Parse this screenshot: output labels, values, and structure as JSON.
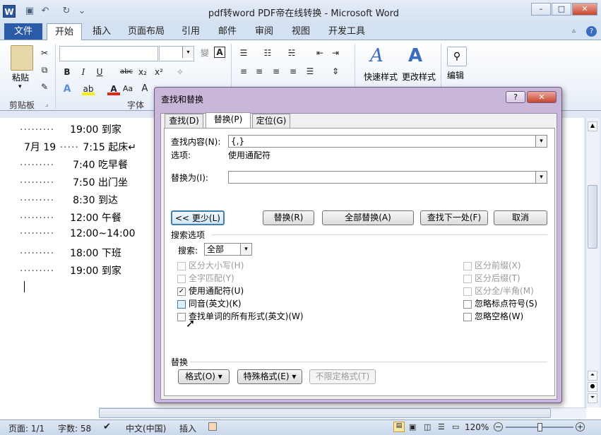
{
  "window": {
    "title": "pdf转word PDF帝在线转换 - Microsoft Word",
    "app_icon": "W",
    "controls": {
      "minimize": "–",
      "maximize": "□",
      "close": "✕"
    }
  },
  "tabs": {
    "file": "文件",
    "items": [
      "开始",
      "插入",
      "页面布局",
      "引用",
      "邮件",
      "审阅",
      "视图",
      "开发工具"
    ]
  },
  "ribbon": {
    "clipboard": {
      "paste": "粘贴",
      "label": "剪贴板"
    },
    "font": {
      "label": "字体"
    },
    "styles": {
      "quick": "快速样式",
      "change": "更改样式"
    },
    "editing": {
      "label": "编辑"
    }
  },
  "document": {
    "lines": [
      {
        "prefix": "·········",
        "time": "19:00",
        "text": "到家"
      },
      {
        "prefix": "7月 19",
        "time": "7:15",
        "text": "起床↵"
      },
      {
        "prefix": "·········",
        "time": "7:40",
        "text": "吃早餐"
      },
      {
        "prefix": "·········",
        "time": "7:50",
        "text": "出门坐"
      },
      {
        "prefix": "·········",
        "time": "8:30",
        "text": "到达"
      },
      {
        "prefix": "·········",
        "time": "12:00",
        "text": "午餐"
      },
      {
        "prefix": "·········",
        "time": "12:00~14:00",
        "text": ""
      },
      {
        "prefix": "·········",
        "time": "18:00",
        "text": "下班"
      },
      {
        "prefix": "·········",
        "time": "19:00",
        "text": "到家"
      }
    ]
  },
  "dialog": {
    "title": "查找和替换",
    "help": "?",
    "close": "✕",
    "tabs": [
      "查找(D)",
      "替换(P)",
      "定位(G)"
    ],
    "find_label": "查找内容(N):",
    "find_value": "{,}",
    "options_label": "选项:",
    "options_value": "使用通配符",
    "replace_label": "替换为(I):",
    "replace_value": "",
    "buttons": {
      "less": "<< 更少(L)",
      "replace": "替换(R)",
      "replace_all": "全部替换(A)",
      "find_next": "查找下一处(F)",
      "cancel": "取消"
    },
    "search_options_title": "搜索选项",
    "search_label": "搜索:",
    "search_value": "全部",
    "left_options": [
      {
        "label": "区分大小写(H)",
        "checked": false,
        "enabled": false
      },
      {
        "label": "全字匹配(Y)",
        "checked": false,
        "enabled": false
      },
      {
        "label": "使用通配符(U)",
        "checked": true,
        "enabled": true
      },
      {
        "label": "同音(英文)(K)",
        "checked": false,
        "enabled": true
      },
      {
        "label": "查找单词的所有形式(英文)(W)",
        "checked": false,
        "enabled": true
      }
    ],
    "right_options": [
      {
        "label": "区分前缀(X)",
        "checked": false,
        "enabled": false
      },
      {
        "label": "区分后缀(T)",
        "checked": false,
        "enabled": false
      },
      {
        "label": "区分全/半角(M)",
        "checked": false,
        "enabled": false
      },
      {
        "label": "忽略标点符号(S)",
        "checked": false,
        "enabled": true
      },
      {
        "label": "忽略空格(W)",
        "checked": false,
        "enabled": true
      }
    ],
    "replace_section": "替换",
    "format_btn": "格式(O) ▾",
    "special_btn": "特殊格式(E) ▾",
    "no_format_btn": "不限定格式(T)"
  },
  "status": {
    "page": "页面: 1/1",
    "words": "字数: 58",
    "lang": "中文(中国)",
    "mode": "插入",
    "zoom": "120%"
  }
}
